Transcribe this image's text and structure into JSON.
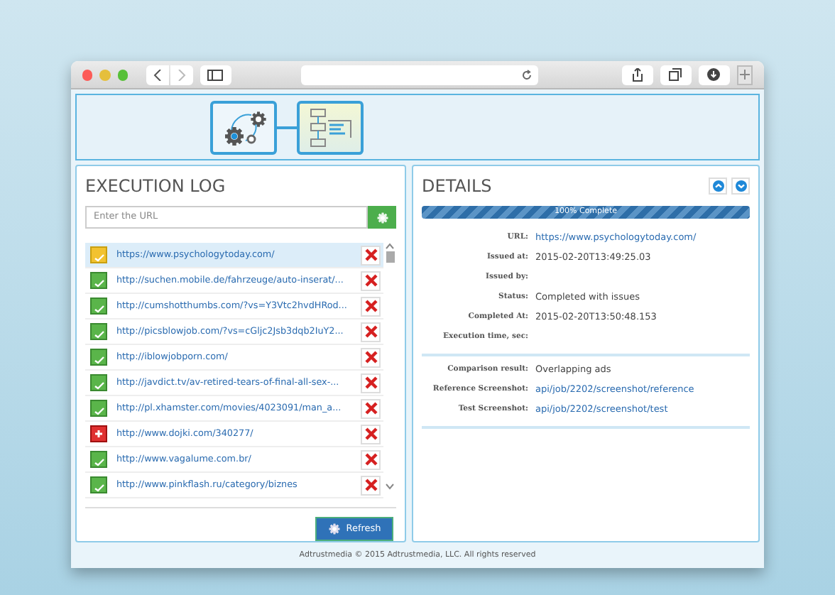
{
  "execution_log": {
    "title": "EXECUTION LOG",
    "url_field": {
      "placeholder": "Enter the URL"
    },
    "items": [
      {
        "url": "https://www.psychologytoday.com/",
        "kind": "warning",
        "selected": true
      },
      {
        "url": "http://suchen.mobile.de/fahrzeuge/auto-inserat/...",
        "kind": "ok",
        "selected": false
      },
      {
        "url": "http://cumshotthumbs.com/?vs=Y3Vtc2hvdHRod...",
        "kind": "ok",
        "selected": false
      },
      {
        "url": "http://picsblowjob.com/?vs=cGljc2Jsb3dqb2IuY2...",
        "kind": "ok",
        "selected": false
      },
      {
        "url": "http://iblowjobporn.com/",
        "kind": "ok",
        "selected": false
      },
      {
        "url": "http://javdict.tv/av-retired-tears-of-final-all-sex-...",
        "kind": "ok",
        "selected": false
      },
      {
        "url": "http://pl.xhamster.com/movies/4023091/man_a...",
        "kind": "ok",
        "selected": false
      },
      {
        "url": "http://www.dojki.com/340277/",
        "kind": "error",
        "selected": false
      },
      {
        "url": "http://www.vagalume.com.br/",
        "kind": "ok",
        "selected": false
      },
      {
        "url": "http://www.pinkflash.ru/category/biznes",
        "kind": "ok",
        "selected": false
      }
    ],
    "refresh_button": "Refresh"
  },
  "details": {
    "title": "DETAILS",
    "progress": {
      "level": 1,
      "label": "100% Complete"
    },
    "sections": [
      [
        {
          "label": "URL:",
          "value": "https://www.psychologytoday.com/",
          "kind": "link"
        },
        {
          "label": "Issued at:",
          "value": "2015-02-20T13:49:25.03",
          "kind": "text"
        },
        {
          "label": "Issued by:"
        },
        {
          "label": "Status:",
          "value": "Completed with issues",
          "kind": "text"
        },
        {
          "label": "Completed At:",
          "value": "2015-02-20T13:50:48.153",
          "kind": "text"
        },
        {
          "label": "Execution time, sec:"
        }
      ],
      [
        {
          "label": "Comparison result:",
          "value": "Overlapping ads",
          "kind": "text"
        },
        {
          "label": "Reference Screenshot:",
          "value": "api/job/2202/screenshot/reference",
          "kind": "link"
        },
        {
          "label": "Test Screenshot:",
          "value": "api/job/2202/screenshot/test",
          "kind": "link"
        }
      ]
    ]
  },
  "footer": "Adtrustmedia © 2015 Adtrustmedia, LLC. All rights reserved"
}
